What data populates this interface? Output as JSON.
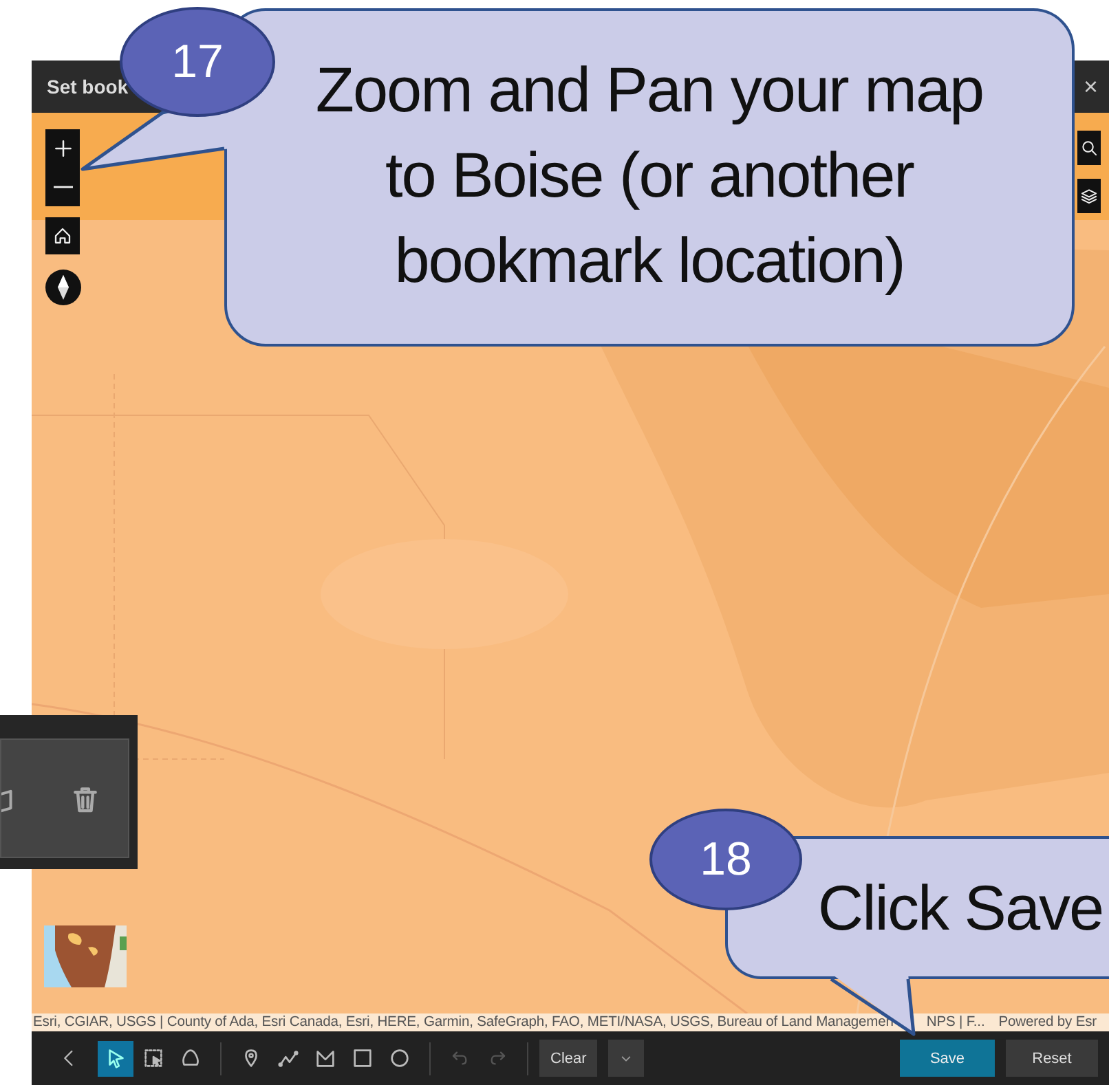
{
  "window": {
    "title": "Set book",
    "close": "×"
  },
  "attribution": [
    "Esri, CGIAR, USGS | County of Ada, Esri Canada, Esri, HERE, Garmin, SafeGraph, FAO, METI/NASA, USGS, Bureau of Land Managemen",
    "NPS | F...",
    "Powered by Esr"
  ],
  "toolbar": {
    "tools": [
      {
        "kind": "select",
        "selected": true
      },
      {
        "kind": "rect-select",
        "selected": false
      },
      {
        "kind": "lasso",
        "selected": false
      },
      {
        "kind": "point",
        "selected": false
      },
      {
        "kind": "polyline",
        "selected": false
      },
      {
        "kind": "polygon",
        "selected": false
      },
      {
        "kind": "rectangle",
        "selected": false
      },
      {
        "kind": "circle",
        "selected": false
      }
    ],
    "history": [
      {
        "kind": "undo",
        "disabled": true
      },
      {
        "kind": "redo",
        "disabled": true
      }
    ],
    "clear": "Clear",
    "save": "Save",
    "reset": "Reset"
  },
  "callouts": [
    {
      "step": "17",
      "lines": [
        "Zoom and Pan your map",
        "to Boise (or another",
        "bookmark location)"
      ]
    },
    {
      "step": "18",
      "lines": [
        "Click Save"
      ]
    }
  ]
}
